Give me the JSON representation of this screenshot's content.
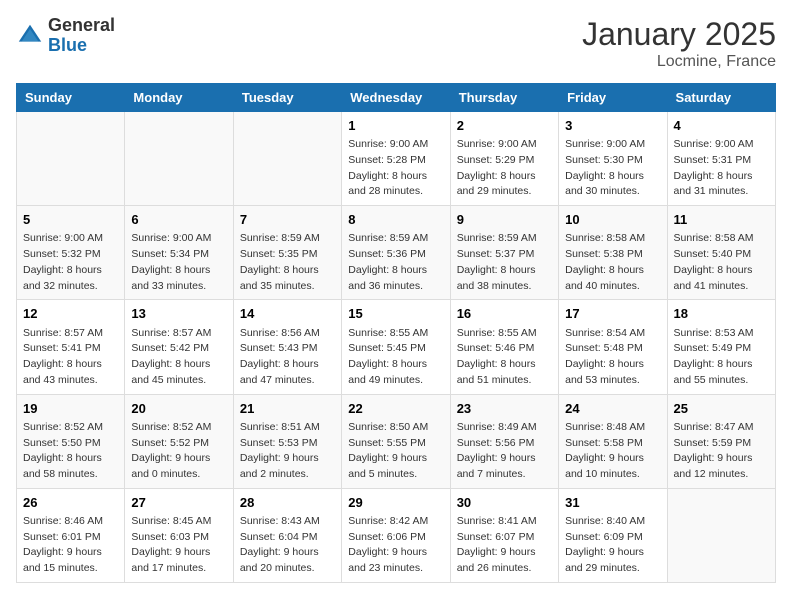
{
  "header": {
    "logo_general": "General",
    "logo_blue": "Blue",
    "month": "January 2025",
    "location": "Locmine, France"
  },
  "weekdays": [
    "Sunday",
    "Monday",
    "Tuesday",
    "Wednesday",
    "Thursday",
    "Friday",
    "Saturday"
  ],
  "weeks": [
    [
      {
        "day": "",
        "info": ""
      },
      {
        "day": "",
        "info": ""
      },
      {
        "day": "",
        "info": ""
      },
      {
        "day": "1",
        "info": "Sunrise: 9:00 AM\nSunset: 5:28 PM\nDaylight: 8 hours\nand 28 minutes."
      },
      {
        "day": "2",
        "info": "Sunrise: 9:00 AM\nSunset: 5:29 PM\nDaylight: 8 hours\nand 29 minutes."
      },
      {
        "day": "3",
        "info": "Sunrise: 9:00 AM\nSunset: 5:30 PM\nDaylight: 8 hours\nand 30 minutes."
      },
      {
        "day": "4",
        "info": "Sunrise: 9:00 AM\nSunset: 5:31 PM\nDaylight: 8 hours\nand 31 minutes."
      }
    ],
    [
      {
        "day": "5",
        "info": "Sunrise: 9:00 AM\nSunset: 5:32 PM\nDaylight: 8 hours\nand 32 minutes."
      },
      {
        "day": "6",
        "info": "Sunrise: 9:00 AM\nSunset: 5:34 PM\nDaylight: 8 hours\nand 33 minutes."
      },
      {
        "day": "7",
        "info": "Sunrise: 8:59 AM\nSunset: 5:35 PM\nDaylight: 8 hours\nand 35 minutes."
      },
      {
        "day": "8",
        "info": "Sunrise: 8:59 AM\nSunset: 5:36 PM\nDaylight: 8 hours\nand 36 minutes."
      },
      {
        "day": "9",
        "info": "Sunrise: 8:59 AM\nSunset: 5:37 PM\nDaylight: 8 hours\nand 38 minutes."
      },
      {
        "day": "10",
        "info": "Sunrise: 8:58 AM\nSunset: 5:38 PM\nDaylight: 8 hours\nand 40 minutes."
      },
      {
        "day": "11",
        "info": "Sunrise: 8:58 AM\nSunset: 5:40 PM\nDaylight: 8 hours\nand 41 minutes."
      }
    ],
    [
      {
        "day": "12",
        "info": "Sunrise: 8:57 AM\nSunset: 5:41 PM\nDaylight: 8 hours\nand 43 minutes."
      },
      {
        "day": "13",
        "info": "Sunrise: 8:57 AM\nSunset: 5:42 PM\nDaylight: 8 hours\nand 45 minutes."
      },
      {
        "day": "14",
        "info": "Sunrise: 8:56 AM\nSunset: 5:43 PM\nDaylight: 8 hours\nand 47 minutes."
      },
      {
        "day": "15",
        "info": "Sunrise: 8:55 AM\nSunset: 5:45 PM\nDaylight: 8 hours\nand 49 minutes."
      },
      {
        "day": "16",
        "info": "Sunrise: 8:55 AM\nSunset: 5:46 PM\nDaylight: 8 hours\nand 51 minutes."
      },
      {
        "day": "17",
        "info": "Sunrise: 8:54 AM\nSunset: 5:48 PM\nDaylight: 8 hours\nand 53 minutes."
      },
      {
        "day": "18",
        "info": "Sunrise: 8:53 AM\nSunset: 5:49 PM\nDaylight: 8 hours\nand 55 minutes."
      }
    ],
    [
      {
        "day": "19",
        "info": "Sunrise: 8:52 AM\nSunset: 5:50 PM\nDaylight: 8 hours\nand 58 minutes."
      },
      {
        "day": "20",
        "info": "Sunrise: 8:52 AM\nSunset: 5:52 PM\nDaylight: 9 hours\nand 0 minutes."
      },
      {
        "day": "21",
        "info": "Sunrise: 8:51 AM\nSunset: 5:53 PM\nDaylight: 9 hours\nand 2 minutes."
      },
      {
        "day": "22",
        "info": "Sunrise: 8:50 AM\nSunset: 5:55 PM\nDaylight: 9 hours\nand 5 minutes."
      },
      {
        "day": "23",
        "info": "Sunrise: 8:49 AM\nSunset: 5:56 PM\nDaylight: 9 hours\nand 7 minutes."
      },
      {
        "day": "24",
        "info": "Sunrise: 8:48 AM\nSunset: 5:58 PM\nDaylight: 9 hours\nand 10 minutes."
      },
      {
        "day": "25",
        "info": "Sunrise: 8:47 AM\nSunset: 5:59 PM\nDaylight: 9 hours\nand 12 minutes."
      }
    ],
    [
      {
        "day": "26",
        "info": "Sunrise: 8:46 AM\nSunset: 6:01 PM\nDaylight: 9 hours\nand 15 minutes."
      },
      {
        "day": "27",
        "info": "Sunrise: 8:45 AM\nSunset: 6:03 PM\nDaylight: 9 hours\nand 17 minutes."
      },
      {
        "day": "28",
        "info": "Sunrise: 8:43 AM\nSunset: 6:04 PM\nDaylight: 9 hours\nand 20 minutes."
      },
      {
        "day": "29",
        "info": "Sunrise: 8:42 AM\nSunset: 6:06 PM\nDaylight: 9 hours\nand 23 minutes."
      },
      {
        "day": "30",
        "info": "Sunrise: 8:41 AM\nSunset: 6:07 PM\nDaylight: 9 hours\nand 26 minutes."
      },
      {
        "day": "31",
        "info": "Sunrise: 8:40 AM\nSunset: 6:09 PM\nDaylight: 9 hours\nand 29 minutes."
      },
      {
        "day": "",
        "info": ""
      }
    ]
  ]
}
